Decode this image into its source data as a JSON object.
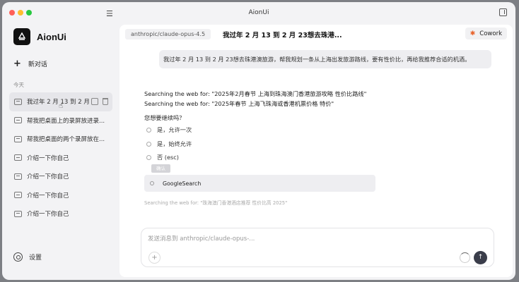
{
  "window": {
    "title": "AionUi"
  },
  "sidebar": {
    "app_name": "AionUi",
    "new_chat_label": "新对话",
    "section_today": "今天",
    "history": [
      {
        "label": "我过年 2 月 13 到 2 月",
        "active": true
      },
      {
        "label": "帮我把桌面上的录屏放进录...",
        "active": false
      },
      {
        "label": "帮我把桌面的两个录屏放在...",
        "active": false
      },
      {
        "label": "介绍一下你自己",
        "active": false
      },
      {
        "label": "介绍一下你自己",
        "active": false
      },
      {
        "label": "介绍一下你自己",
        "active": false
      },
      {
        "label": "介绍一下你自己",
        "active": false
      }
    ],
    "settings_label": "设置"
  },
  "main": {
    "model_tab": "anthropic/claude-opus-4.5",
    "conversation_title": "我过年 2 月 13 到 2 月 23想去珠港...",
    "cowork_label": "Cowork",
    "user_message": "我过年 2 月 13 到 2 月 23想去珠港澳旅游，帮我规划一条从上海出发旅游路线，要有性价比，再给我推荐合适的机酒。",
    "search_lines": [
      "Searching the web for: \"2025年2月春节 上海到珠海澳门香港旅游攻略 性价比路线\"",
      "Searching the web for: \"2025年春节 上海飞珠海或香港机票价格 特价\""
    ],
    "prompt_question": "您想要继续吗？",
    "options": [
      "是，允许一次",
      "是，始终允许",
      "否 (esc)"
    ],
    "submit_label": "确认",
    "tool_name": "GoogleSearch",
    "faded_search": "Searching the web for: \"珠海澳门香港酒店推荐 性价比高 2025\"",
    "composer_placeholder": "发送消息到 anthropic/claude-opus-..."
  },
  "colors": {
    "accent": "#e8622a",
    "send_button": "#3a3d4a"
  }
}
